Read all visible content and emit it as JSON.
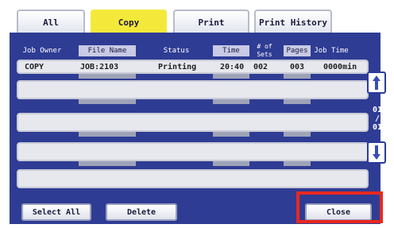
{
  "tabs": [
    {
      "label": "All",
      "active": false
    },
    {
      "label": "Copy",
      "active": true
    },
    {
      "label": "Print",
      "active": false
    },
    {
      "label": "Print History",
      "active": false
    }
  ],
  "columns": {
    "owner": "Job Owner",
    "file": "File Name",
    "status": "Status",
    "time": "Time",
    "sets": "# of Sets",
    "pages": "Pages",
    "jobtime": "Job Time"
  },
  "rows": [
    {
      "owner": "COPY",
      "file": "JOB:2103",
      "status": "Printing",
      "time": "20:40",
      "sets": "002",
      "pages": "003",
      "jobtime": "0000min"
    }
  ],
  "page_indicator": {
    "current": "01",
    "sep": "/",
    "total": "01"
  },
  "buttons": {
    "select_all": "Select All",
    "delete": "Delete",
    "close": "Close"
  },
  "colors": {
    "panel": "#2f3c94",
    "active_tab": "#f4e93a",
    "highlight": "#e8281e"
  }
}
